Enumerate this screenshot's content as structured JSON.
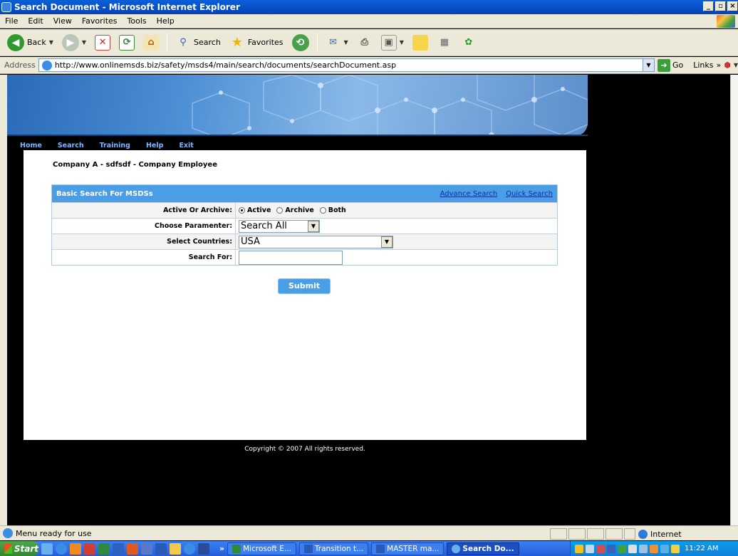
{
  "window": {
    "title": "Search Document - Microsoft Internet Explorer"
  },
  "menu": [
    "File",
    "Edit",
    "View",
    "Favorites",
    "Tools",
    "Help"
  ],
  "toolbar": {
    "back": "Back",
    "search": "Search",
    "favorites": "Favorites"
  },
  "address": {
    "label": "Address",
    "url": "http://www.onlinemsds.biz/safety/msds4/main/search/documents/searchDocument.asp",
    "go": "Go",
    "links": "Links"
  },
  "nav": [
    "Home",
    "Search",
    "Training",
    "Help",
    "Exit"
  ],
  "company_line": "Company A - sdfsdf - Company Employee",
  "search": {
    "heading": "Basic Search For MSDSs",
    "advance_link": "Advance Search",
    "quick_link": "Quick Search",
    "active_label": "Active Or Archive:",
    "radio_active": "Active",
    "radio_archive": "Archive",
    "radio_both": "Both",
    "parameter_label": "Choose Paramenter:",
    "parameter_value": "Search All",
    "countries_label": "Select Countries:",
    "countries_value": "USA",
    "searchfor_label": "Search For:",
    "searchfor_value": "",
    "submit": "Submit"
  },
  "copyright": "Copyright © 2007 All rights reserved.",
  "status": {
    "text": "Menu ready for use",
    "zone": "Internet"
  },
  "taskbar": {
    "start": "Start",
    "more": "»",
    "tasks": [
      "Microsoft E...",
      "Transition t...",
      "MASTER ma...",
      "Search Do..."
    ],
    "clock": "11:22 AM"
  },
  "colors": {
    "accent": "#4a9ee6",
    "nav_link": "#7db7ff",
    "header_link": "#0a2f9f"
  }
}
